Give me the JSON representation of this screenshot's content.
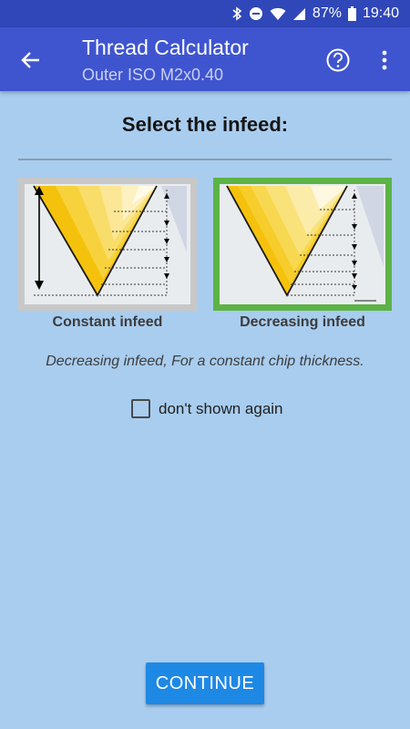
{
  "status_bar": {
    "battery": "87%",
    "time": "19:40",
    "icons": [
      "bluetooth-icon",
      "do-not-disturb-icon",
      "wifi-icon",
      "signal-icon",
      "battery-icon"
    ]
  },
  "app_bar": {
    "title": "Thread Calculator",
    "subtitle": "Outer ISO M2x0.40",
    "icons": [
      "arrow-back-icon",
      "help-circle-icon",
      "more-vert-icon"
    ]
  },
  "heading": "Select the infeed:",
  "options": [
    {
      "label": "Constant infeed",
      "selected": false
    },
    {
      "label": "Decreasing infeed",
      "selected": true
    }
  ],
  "description": "Decreasing infeed, For a constant chip thickness.",
  "checkbox": {
    "label": "don't shown again",
    "checked": false
  },
  "continue_label": "CONTINUE",
  "colors": {
    "status_bar": "#2f47b9",
    "app_bar": "#3f55cf",
    "background": "#a9cdef",
    "selected_frame": "#5cb346",
    "unselected_frame": "#c8c8c8",
    "button": "#1e88e5"
  }
}
